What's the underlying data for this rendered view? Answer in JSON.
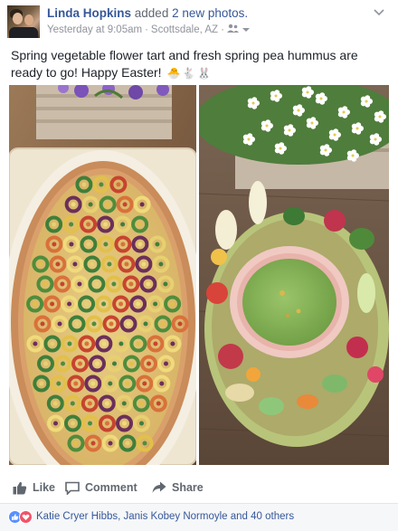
{
  "header": {
    "author_name": "Linda Hopkins",
    "verb": "added",
    "photos_link": "2 new photos.",
    "timestamp": "Yesterday at 9:05am",
    "separator": "·",
    "location": "Scottsdale, AZ",
    "separator2": "·"
  },
  "post": {
    "text": "Spring vegetable flower tart and fresh spring pea hummus are ready to go! Happy Easter!",
    "emojis": [
      "🐣",
      "🐇",
      "🐰"
    ]
  },
  "actions": {
    "like_label": "Like",
    "comment_label": "Comment",
    "share_label": "Share"
  },
  "reactions": {
    "summary": "Katie Cryer Hibbs, Janis Kobey Normoyle and 40 others"
  },
  "colors": {
    "link": "#365899",
    "like_blue": "#5890ff",
    "love_red": "#f25268",
    "meta_gray": "#90949c"
  },
  "icons": [
    "avatar",
    "globe-friends-icon",
    "chevron-down-icon",
    "like-thumb-icon",
    "comment-icon",
    "share-icon",
    "like-reaction-icon",
    "love-reaction-icon"
  ]
}
